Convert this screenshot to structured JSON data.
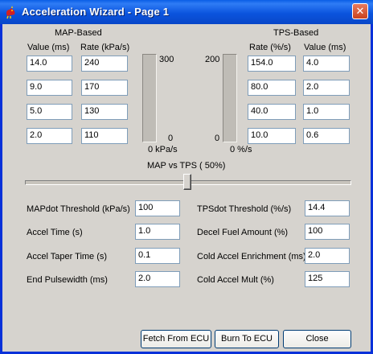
{
  "window": {
    "title": "Acceleration Wizard - Page 1",
    "close_glyph": "✕"
  },
  "map": {
    "heading": "MAP-Based",
    "col_value": "Value (ms)",
    "col_rate": "Rate (kPa/s)",
    "values": [
      "14.0",
      "9.0",
      "5.0",
      "2.0"
    ],
    "rates": [
      "240",
      "170",
      "130",
      "110"
    ],
    "bar_max": "300",
    "bar_min": "0",
    "bar_unit": "0 kPa/s",
    "bar_level": 0
  },
  "tps": {
    "heading": "TPS-Based",
    "col_rate": "Rate (%/s)",
    "col_value": "Value (ms)",
    "rates": [
      "154.0",
      "80.0",
      "40.0",
      "10.0"
    ],
    "values": [
      "4.0",
      "2.0",
      "1.0",
      "0.6"
    ],
    "bar_max": "200",
    "bar_min": "0",
    "bar_unit": "0 %/s",
    "bar_level": 0
  },
  "slider": {
    "label": "MAP vs TPS ( 50%)",
    "value_percent": 50
  },
  "params_left": [
    {
      "label": "MAPdot Threshold (kPa/s)",
      "value": "100"
    },
    {
      "label": "Accel Time (s)",
      "value": "1.0"
    },
    {
      "label": "Accel Taper Time (s)",
      "value": "0.1"
    },
    {
      "label": "End Pulsewidth (ms)",
      "value": "2.0"
    }
  ],
  "params_right": [
    {
      "label": "TPSdot Threshold (%/s)",
      "value": "14.4"
    },
    {
      "label": "Decel Fuel Amount (%)",
      "value": "100"
    },
    {
      "label": "Cold Accel Enrichment (ms)",
      "value": "2.0"
    },
    {
      "label": "Cold Accel Mult (%)",
      "value": "125"
    }
  ],
  "buttons": {
    "fetch": "Fetch From ECU",
    "burn": "Burn To ECU",
    "close": "Close"
  },
  "icons": {
    "app": "rooster-icon",
    "close": "close-icon"
  },
  "colors": {
    "titlebar": "#0b54de",
    "frame": "#0831d9",
    "dialog": "#d6d3ce"
  }
}
